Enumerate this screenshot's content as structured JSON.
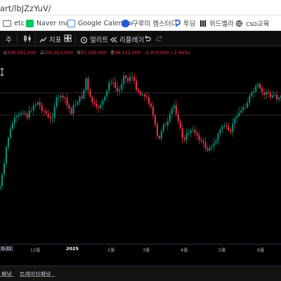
{
  "browser": {
    "url_visible": "art/lbJZzYuV/"
  },
  "bookmarks": [
    {
      "label": "etc",
      "icon": "folder-icon"
    },
    {
      "label": "Naver mail",
      "icon": "naver-mail-icon"
    },
    {
      "label": "Google Calendar",
      "icon": "google-calendar-icon"
    },
    {
      "label": "구루미 캠스터디",
      "icon": "gurumi-icon"
    },
    {
      "label": "투딩",
      "icon": "tooding-icon"
    },
    {
      "label": "위드벨라",
      "icon": "withbella-icon"
    },
    {
      "label": "cso교육",
      "icon": "globe-icon"
    }
  ],
  "toolbar": {
    "interval_label": "주",
    "indicators_label": "지표",
    "alerts_label": "얼리트",
    "replay_label": "리플레이"
  },
  "ohlc": {
    "open_key": "시",
    "open_value": "100,591,000",
    "high_key": "고",
    "high_value": "100,923,000",
    "low_key": "저",
    "low_value": "97,250,000",
    "close_key": "종",
    "close_value": "98,122,000",
    "change_value": "-2,470,000 (-2.46%)"
  },
  "xaxis": {
    "current_label": "0-31",
    "ticks": [
      "12월",
      "2025",
      "2월",
      "3월",
      "4월",
      "5월",
      "6월"
    ]
  },
  "bottom_tabs": {
    "panel_label": "패널",
    "trading_panel_label": "트레이딩패널"
  },
  "colors": {
    "up_candle": "#089981",
    "down_candle": "#f23645",
    "chart_background": "#000000",
    "toolbar_background": "#0d0d0d"
  },
  "chart_data": {
    "type": "candlestick",
    "guide_levels": [
      132,
      164
    ],
    "close_path": [
      265,
      250,
      235,
      210,
      195,
      185,
      175,
      170,
      168,
      165,
      160,
      158,
      162,
      166,
      160,
      155,
      150,
      148,
      146,
      150,
      155,
      158,
      162,
      168,
      170,
      165,
      150,
      142,
      140,
      135,
      142,
      140,
      150,
      155,
      160,
      152,
      148,
      143,
      140,
      138,
      128,
      112,
      130,
      140,
      145,
      150,
      155,
      152,
      148,
      144,
      140,
      130,
      118,
      115,
      120,
      125,
      130,
      128,
      118,
      105,
      112,
      115,
      108,
      110,
      118,
      125,
      130,
      135,
      132,
      138,
      140,
      145,
      150,
      165,
      180,
      195,
      198,
      185,
      175,
      180,
      175,
      165,
      155,
      150,
      160,
      170,
      185,
      195,
      200,
      192,
      188,
      185,
      182,
      190,
      195,
      198,
      200,
      205,
      210,
      212,
      208,
      210,
      205,
      200,
      190,
      185,
      180,
      178,
      183,
      188,
      190,
      175,
      170,
      162,
      160,
      158,
      152,
      150,
      145,
      138,
      135,
      130,
      125,
      122,
      128,
      132,
      135,
      130,
      133,
      140,
      136,
      135,
      140,
      138,
      135
    ]
  }
}
